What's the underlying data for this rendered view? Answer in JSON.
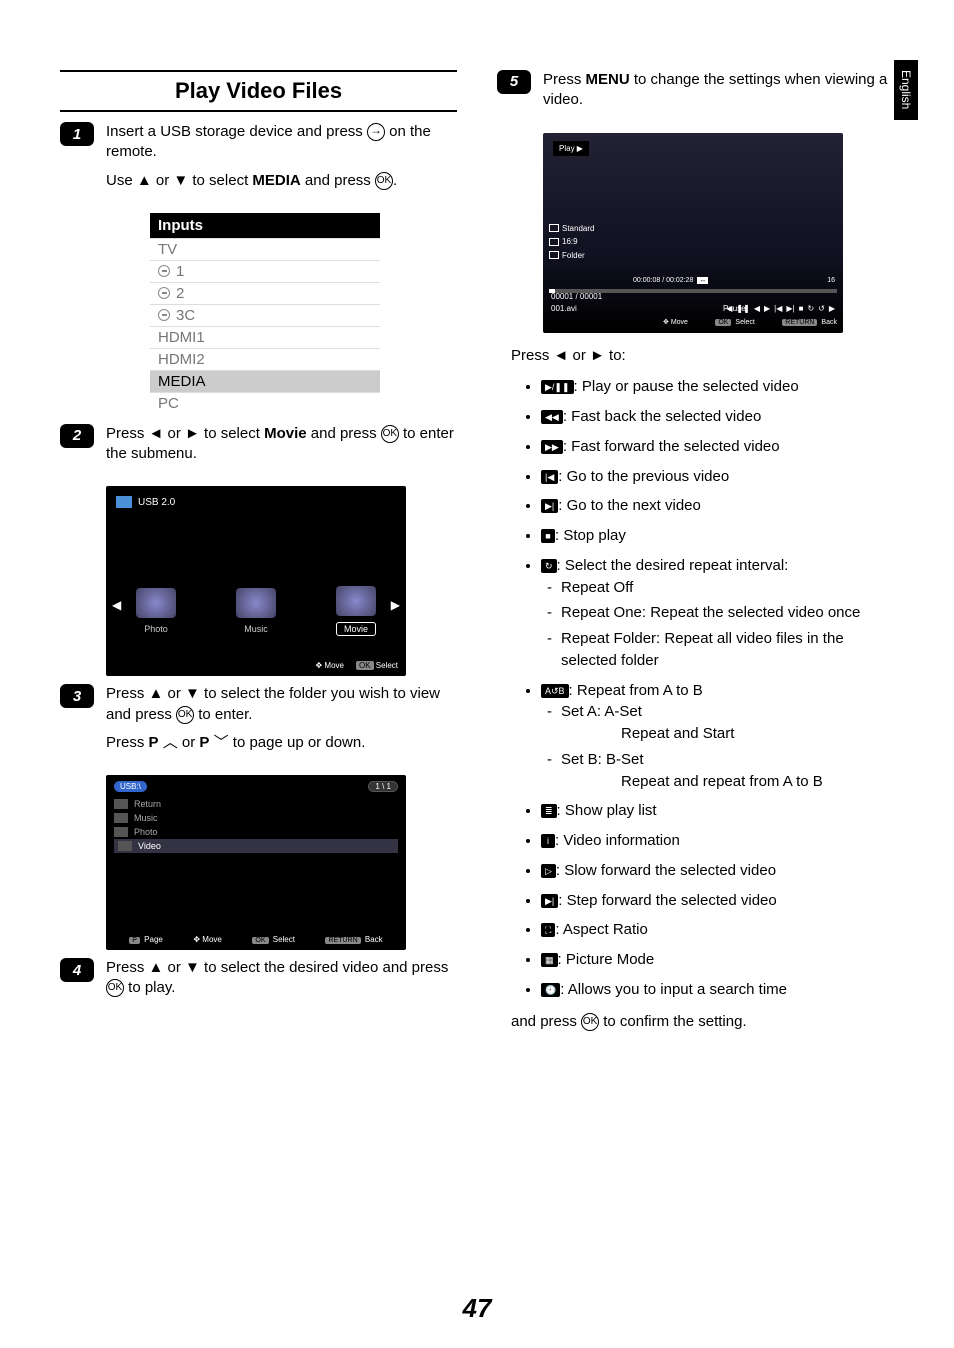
{
  "sideTab": "English",
  "title": "Play Video Files",
  "steps": {
    "s1a": "Insert a USB storage device and  press ",
    "s1b": " on the remote.",
    "s1c": "Use ▲ or ▼ to select ",
    "s1d": "MEDIA",
    "s1e": " and press ",
    "s2a": "Press ◄ or ► to select ",
    "s2b": "Movie",
    "s2c": " and press ",
    "s2d": " to enter the submenu.",
    "s3a": "Press ▲ or ▼ to select the folder you wish to view and press ",
    "s3b": " to enter.",
    "s3c_pre": "Press ",
    "s3c_p1": "P",
    "s3c_mid1": " ",
    "s3c_mid2": " or ",
    "s3c_p2": "P",
    "s3c_end": " to page up or down.",
    "s4a": "Press ▲ or ▼ to select the desired video and press ",
    "s4b": " to play.",
    "s5a": "Press ",
    "s5b": "MENU",
    "s5c": " to change the settings when viewing a video."
  },
  "inputs": {
    "header": "Inputs",
    "rows": [
      "TV",
      "1",
      "2",
      "3C",
      "HDMI1",
      "HDMI2",
      "MEDIA",
      "PC"
    ],
    "selectedIndex": 6
  },
  "mock1": {
    "usb": "USB 2.0",
    "cats": [
      "Photo",
      "Music",
      "Movie"
    ],
    "foot_move": "Move",
    "foot_select": "Select",
    "ok": "OK"
  },
  "mock2": {
    "crumb": "USB:\\",
    "pill": "1 \\ 1",
    "items": [
      "Return",
      "Music",
      "Photo",
      "Video"
    ],
    "foot": {
      "page": "Page",
      "move": "Move",
      "select": "Select",
      "back": "Back",
      "p": "P",
      "ok": "OK",
      "ret": "RETURN"
    }
  },
  "mock3": {
    "play": "Play ▶",
    "tags": [
      "Standard",
      "16:9",
      "Folder"
    ],
    "time": "00:00:08 / 00:02:28",
    "count": "00001 / 00001",
    "file": "001.avi",
    "pause": "Pause",
    "sixteen": "16",
    "foot": {
      "move": "Move",
      "select": "Select",
      "back": "Back",
      "ok": "OK",
      "ret": "RETURN"
    }
  },
  "right": {
    "pressTo": "Press ◄ or ► to:",
    "items": [
      ": Play or pause the selected video",
      ": Fast back the selected video",
      ": Fast forward the selected video",
      ": Go to the previous video",
      ": Go to the next video",
      ": Stop play",
      ": Select the desired repeat interval:",
      ": Repeat from A to B",
      ": Show play list",
      ": Video information",
      ": Slow forward the selected video",
      ": Step forward the selected video",
      ": Aspect Ratio",
      ": Picture Mode",
      ": Allows you to input a search time"
    ],
    "repeatSub": [
      "Repeat Off",
      "Repeat One: Repeat the selected video once",
      "Repeat Folder: Repeat all video files in the selected folder"
    ],
    "abSub": {
      "a1": "Set A: A-Set",
      "a2": "Repeat and Start",
      "b1": "Set B: B-Set",
      "b2": "Repeat and repeat from A to B"
    },
    "confirm_a": "and press ",
    "confirm_b": " to confirm the setting."
  },
  "iconGlyphs": {
    "playPause": "▶/❚❚",
    "fastBack": "◀◀",
    "fastFwd": "▶▶",
    "prev": "|◀",
    "next": "▶|",
    "stop": "■",
    "repeat": "↻",
    "ab": "A↺B",
    "list": "≣",
    "info": "i",
    "slow": "▷",
    "step": "▶|",
    "aspect": "⛶",
    "picmode": "▦",
    "search": "🕘"
  },
  "pageNum": "47"
}
